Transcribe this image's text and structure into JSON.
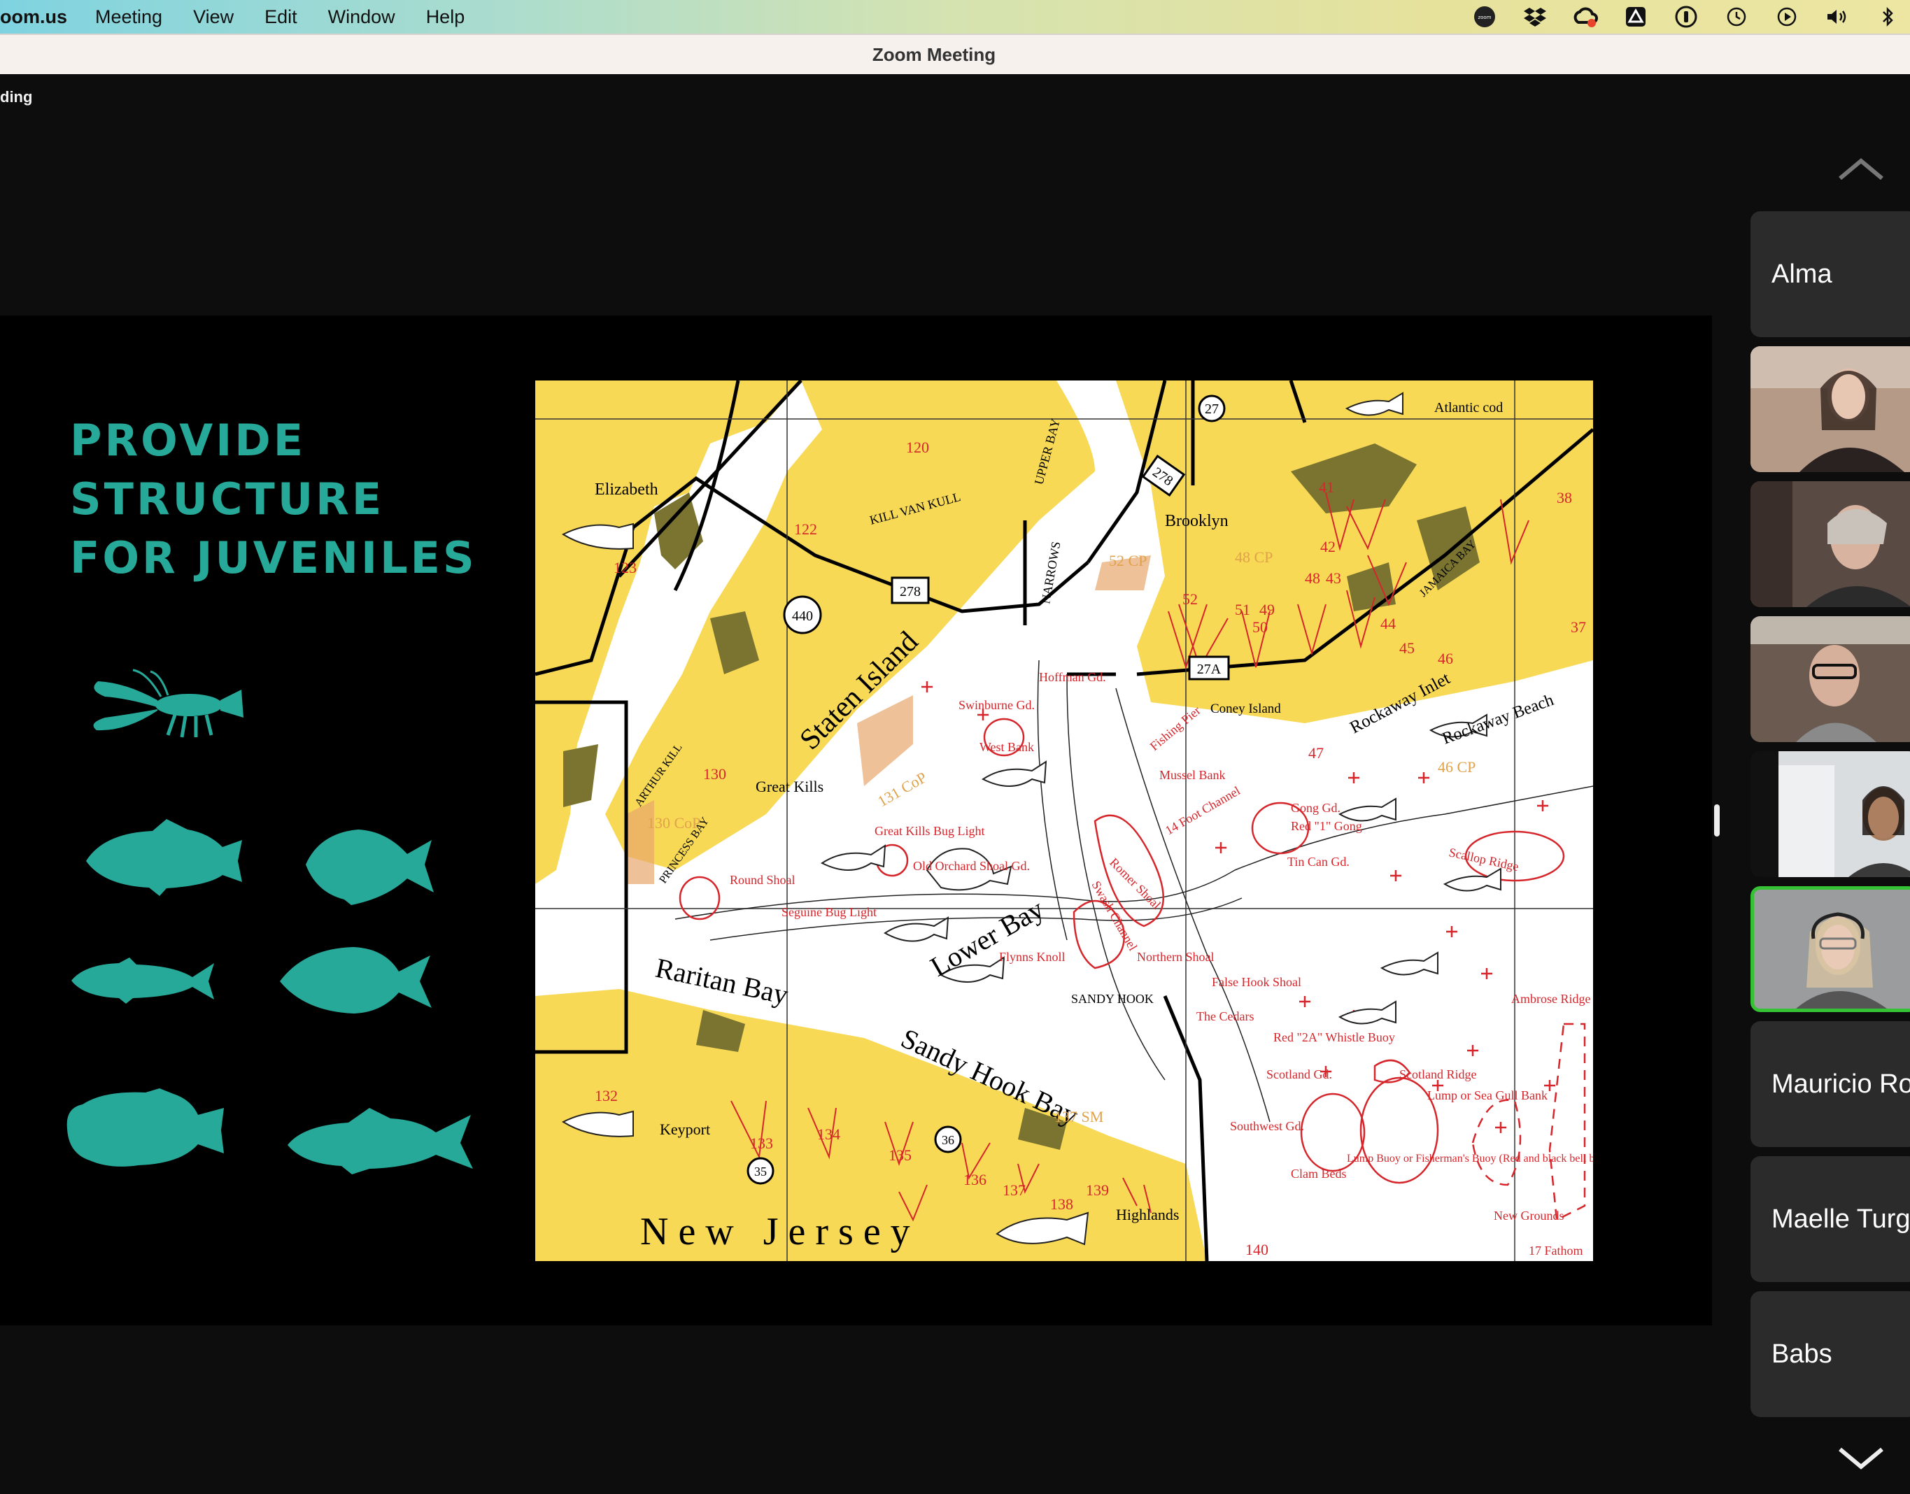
{
  "menubar": {
    "app_name": "oom.us",
    "items": [
      "Meeting",
      "View",
      "Edit",
      "Window",
      "Help"
    ],
    "status_icons": [
      "zoom-icon",
      "dropbox-icon",
      "creative-cloud-icon",
      "google-drive-icon",
      "onepassword-icon",
      "time-machine-icon",
      "play-icon",
      "volume-icon",
      "bluetooth-icon"
    ]
  },
  "window": {
    "title": "Zoom Meeting",
    "recording_label": "ding"
  },
  "slide": {
    "title_lines": [
      "PROVIDE",
      "STRUCTURE",
      "FOR JUVENILES"
    ],
    "accent_color": "#27a99a",
    "map": {
      "places": [
        "Elizabeth",
        "Brooklyn",
        "Staten Island",
        "Great Kills",
        "Coney Island",
        "Rockaway Inlet",
        "Rockaway Beach",
        "Raritan Bay",
        "Lower Bay",
        "Sandy Hook Bay",
        "New Jersey",
        "Keyport",
        "Highlands",
        "KILL VAN KULL",
        "NARROWS",
        "UPPER BAY",
        "JAMAICA BAY",
        "ARTHUR KILL",
        "PRINCESS BAY",
        "SANDY HOOK",
        "Atlantic cod"
      ],
      "spots": [
        "Hoffman Gd.",
        "Swinburne Gd.",
        "West Bank",
        "Great Kills Bug Light",
        "Old Orchard Shoal Gd.",
        "Round Shoal",
        "Seguine Bug Light",
        "Mussel Bank",
        "14 Foot Channel",
        "Gong Gd.",
        "Red \"1\" Gong",
        "Tin Can Gd.",
        "Scallop Ridge",
        "Romer Shoal",
        "Swash Channel",
        "Flynns Knoll",
        "Northern Shoal",
        "False Hook Shoal",
        "The Cedars",
        "Red \"2A\" Whistle Buoy",
        "Scotland Gd.",
        "Scotland Ridge",
        "Lump or Sea Gull Bank",
        "Southwest Gd.",
        "Clam Beds",
        "Lump Buoy or Fisherman's Buoy (Red and black bell buoy)",
        "New Grounds",
        "17 Fathom",
        "Ambrose Ridge",
        "Fishing Pier"
      ],
      "route_markers": [
        "27",
        "278",
        "440",
        "278",
        "27A",
        "36",
        "35"
      ],
      "spot_numbers": [
        "120",
        "122",
        "123",
        "130",
        "131 CoP",
        "130 CoP",
        "132",
        "133",
        "134",
        "135",
        "136",
        "137",
        "137 SM",
        "138",
        "139",
        "140",
        "41",
        "42",
        "43",
        "44",
        "45",
        "46",
        "47",
        "48",
        "49",
        "50",
        "51",
        "52",
        "37",
        "38",
        "46 CP",
        "48 CP",
        "52 CP"
      ]
    }
  },
  "gallery": {
    "participants": [
      {
        "name": "Alma",
        "video": false
      },
      {
        "name": "",
        "video": true
      },
      {
        "name": "",
        "video": true
      },
      {
        "name": "",
        "video": true
      },
      {
        "name": "",
        "video": true
      },
      {
        "name": "",
        "video": true,
        "active_speaker": true
      },
      {
        "name": "Mauricio Ro",
        "video": false
      },
      {
        "name": "Maelle Turg",
        "video": false
      },
      {
        "name": "Babs",
        "video": false
      }
    ]
  }
}
